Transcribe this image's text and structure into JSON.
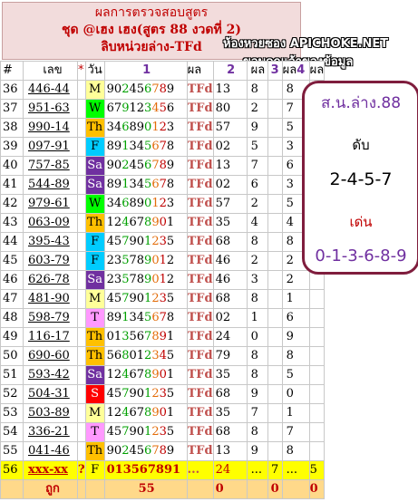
{
  "title": {
    "line1": "ผลการตรวจสอบสูตร",
    "line2": "ชุด @เฮง เฮง(สูตร 88 งวดที่ 2)",
    "line3": "ลิบหน่วยล่าง-TFd"
  },
  "watermark": {
    "line1": "ห้องหวยซอง APICHOKE.NET",
    "line2": "ขอบคุณเจ้าของข้อมูล"
  },
  "header": {
    "no": "#",
    "lek": "เลข",
    "marker": "*",
    "day": "วัน",
    "col1": "1",
    "result": "ผล",
    "col2": "2",
    "result2": "ผล",
    "col3": "3",
    "result3": "ผล",
    "col4": "4",
    "result4": "ผล"
  },
  "rows": [
    {
      "no": "36",
      "lek": "446-44",
      "day": "M",
      "digits": "902456789",
      "tfd": "TFd",
      "n2": "13",
      "n3": "8",
      "n4": "",
      "n5": "8"
    },
    {
      "no": "37",
      "lek": "951-63",
      "day": "W",
      "digits": "679123456",
      "tfd": "TFd",
      "n2": "80",
      "n3": "2",
      "n4": "",
      "n5": "7"
    },
    {
      "no": "38",
      "lek": "990-14",
      "day": "Th",
      "digits": "346890123",
      "tfd": "TFd",
      "n2": "57",
      "n3": "9",
      "n4": "",
      "n5": "5"
    },
    {
      "no": "39",
      "lek": "097-91",
      "day": "F",
      "digits": "891345678",
      "tfd": "TFd",
      "n2": "02",
      "n3": "5",
      "n4": "",
      "n5": "3"
    },
    {
      "no": "40",
      "lek": "757-85",
      "day": "Sa",
      "digits": "902456789",
      "tfd": "TFd",
      "n2": "13",
      "n3": "7",
      "n4": "",
      "n5": "6"
    },
    {
      "no": "41",
      "lek": "544-89",
      "day": "Sa",
      "digits": "891345678",
      "tfd": "TFd",
      "n2": "02",
      "n3": "6",
      "n4": "",
      "n5": "3"
    },
    {
      "no": "42",
      "lek": "979-61",
      "day": "W",
      "digits": "346890123",
      "tfd": "TFd",
      "n2": "57",
      "n3": "2",
      "n4": "",
      "n5": "5"
    },
    {
      "no": "43",
      "lek": "063-09",
      "day": "Th",
      "digits": "124678901",
      "tfd": "TFd",
      "n2": "35",
      "n3": "4",
      "n4": "",
      "n5": "4"
    },
    {
      "no": "44",
      "lek": "395-43",
      "day": "F",
      "digits": "457901235",
      "tfd": "TFd",
      "n2": "68",
      "n3": "8",
      "n4": "",
      "n5": "8"
    },
    {
      "no": "45",
      "lek": "603-79",
      "day": "F",
      "digits": "235789012",
      "tfd": "TFd",
      "n2": "46",
      "n3": "2",
      "n4": "",
      "n5": "2"
    },
    {
      "no": "46",
      "lek": "626-78",
      "day": "Sa",
      "digits": "235789012",
      "tfd": "TFd",
      "n2": "46",
      "n3": "3",
      "n4": "",
      "n5": "2"
    },
    {
      "no": "47",
      "lek": "481-90",
      "day": "M",
      "digits": "457901235",
      "tfd": "TFd",
      "n2": "68",
      "n3": "8",
      "n4": "",
      "n5": "1"
    },
    {
      "no": "48",
      "lek": "598-79",
      "day": "T",
      "digits": "891345678",
      "tfd": "TFd",
      "n2": "02",
      "n3": "1",
      "n4": "",
      "n5": "6"
    },
    {
      "no": "49",
      "lek": "116-17",
      "day": "Th",
      "digits": "013567891",
      "tfd": "TFd",
      "n2": "24",
      "n3": "0",
      "n4": "",
      "n5": "9"
    },
    {
      "no": "50",
      "lek": "690-60",
      "day": "Th",
      "digits": "568012345",
      "tfd": "TFd",
      "n2": "79",
      "n3": "8",
      "n4": "",
      "n5": "8"
    },
    {
      "no": "51",
      "lek": "593-42",
      "day": "Sa",
      "digits": "124678901",
      "tfd": "TFd",
      "n2": "35",
      "n3": "8",
      "n4": "",
      "n5": "5"
    },
    {
      "no": "52",
      "lek": "504-31",
      "day": "S",
      "digits": "457901235",
      "tfd": "TFd",
      "n2": "68",
      "n3": "9",
      "n4": "",
      "n5": "0"
    },
    {
      "no": "53",
      "lek": "503-89",
      "day": "M",
      "digits": "124678901",
      "tfd": "TFd",
      "n2": "35",
      "n3": "7",
      "n4": "",
      "n5": "1"
    },
    {
      "no": "54",
      "lek": "336-21",
      "day": "T",
      "digits": "457901235",
      "tfd": "TFd",
      "n2": "68",
      "n3": "8",
      "n4": "",
      "n5": "7"
    },
    {
      "no": "55",
      "lek": "041-46",
      "day": "Th",
      "digits": "902456789",
      "tfd": "TFd",
      "n2": "13",
      "n3": "9",
      "n4": "",
      "n5": "8"
    }
  ],
  "highlight_row": {
    "no": "56",
    "lek": "xxx-xx",
    "marker": "?",
    "day": "F",
    "digits": "013567891",
    "dots1": "...",
    "n2": "24",
    "dots2": "...",
    "n3": "7",
    "dots3": "...",
    "n5": "5",
    "dots4": "..."
  },
  "sum_row": {
    "no": "",
    "label": "ถูก",
    "val1": "55",
    "val2": "0",
    "val3": "0",
    "val4": "0"
  },
  "side": {
    "title": "ส.น.ล่าง.88",
    "label1": "ดับ",
    "value1": "2-4-5-7",
    "label2": "เด่น",
    "value2": "0-1-3-6-8-9"
  }
}
